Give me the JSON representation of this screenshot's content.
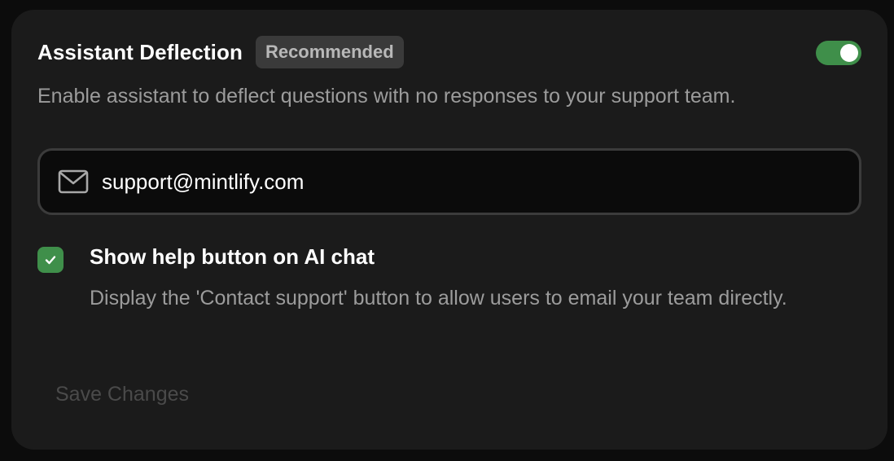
{
  "section": {
    "title": "Assistant Deflection",
    "badge": "Recommended",
    "toggle_enabled": true,
    "description": "Enable assistant to deflect questions with no responses to your support team."
  },
  "email_field": {
    "icon": "mail-icon",
    "value": "support@mintlify.com"
  },
  "help_option": {
    "checked": true,
    "title": "Show help button on AI chat",
    "description": "Display the 'Contact support' button to allow users to email your team directly."
  },
  "actions": {
    "save_label": "Save Changes"
  },
  "colors": {
    "accent_green": "#3f8f4a",
    "card_bg": "#1b1b1b",
    "page_bg": "#0c0c0c"
  }
}
